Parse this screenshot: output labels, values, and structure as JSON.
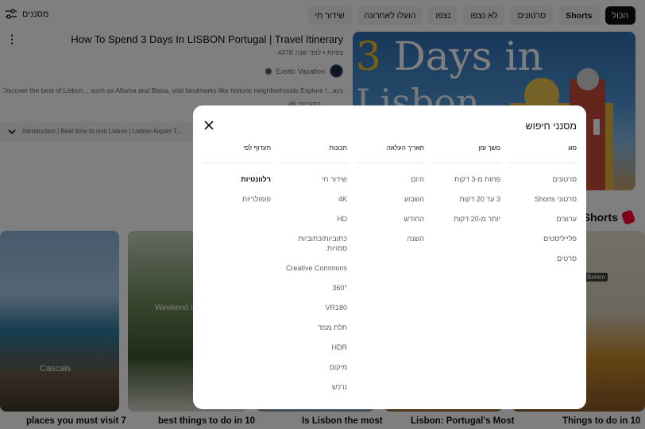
{
  "topbar": {
    "filters_label": "מסננים",
    "chips": [
      {
        "label": "הכול",
        "active": true
      },
      {
        "label": "Shorts"
      },
      {
        "label": "סרטונים"
      },
      {
        "label": "לא נצפו"
      },
      {
        "label": "נצפו"
      },
      {
        "label": "הועלו לאחרונה"
      },
      {
        "label": "שידור חי"
      }
    ]
  },
  "video": {
    "title": "How To Spend 3 Days In LISBON Portugal | Travel Itinerary",
    "meta": "437K צפיות • לפני שנה",
    "channel": "Exotic Vacation",
    "description": "Discover the best of Lisbon... such as Alfama and Baixa, visit landmarks like historic neighborhoods Explore !...ays",
    "desc_line2": "4K",
    "desc_line2b": "כתוביות",
    "chapters": "Introduction | Best time to visit Lisbon | Lisbon Airport T...",
    "thumb_text_num": "3",
    "thumb_text_rest": " Days in",
    "thumb_text_line2": "Lisbon"
  },
  "shorts": {
    "title": "Shorts",
    "items": [
      {
        "title": "places you must visit 7",
        "overlay": "Cascais"
      },
      {
        "title": "best things to do in 10",
        "overlay": "Weekend in"
      },
      {
        "title": "Is Lisbon the most"
      },
      {
        "title": "Lisbon: Portugal's Most"
      },
      {
        "title": "Things to do in 10",
        "badge": "Belém"
      }
    ]
  },
  "dialog": {
    "title": "מסנני חיפוש",
    "columns": [
      {
        "head": "סוג",
        "items": [
          "סרטונים",
          "סרטוני Shorts",
          "ערוצים",
          "פלייליסטים",
          "סרטים"
        ]
      },
      {
        "head": "משך זמן",
        "items": [
          "פחות מ-3 דקות",
          "3 עד 20 דקות",
          "יותר מ-20 דקות"
        ]
      },
      {
        "head": "תאריך העלאה",
        "items": [
          "היום",
          "השבוע",
          "החודש",
          "השנה"
        ]
      },
      {
        "head": "תכונות",
        "items": [
          "שידור חי",
          "4K",
          "HD",
          "כתוביות/כתוביות סמויות",
          "Creative Commons",
          "360°",
          "VR180",
          "תלת ממד",
          "HDR",
          "מיקום",
          "נרכש"
        ]
      },
      {
        "head": "תעדוף לפי",
        "items": [
          "רלוונטיות",
          "פופולריות"
        ],
        "selected": 0
      }
    ]
  },
  "colors": {
    "accent": "#ff0033",
    "chip_bg": "#f2f2f2",
    "scrim": "rgba(0,0,0,0.5)"
  }
}
